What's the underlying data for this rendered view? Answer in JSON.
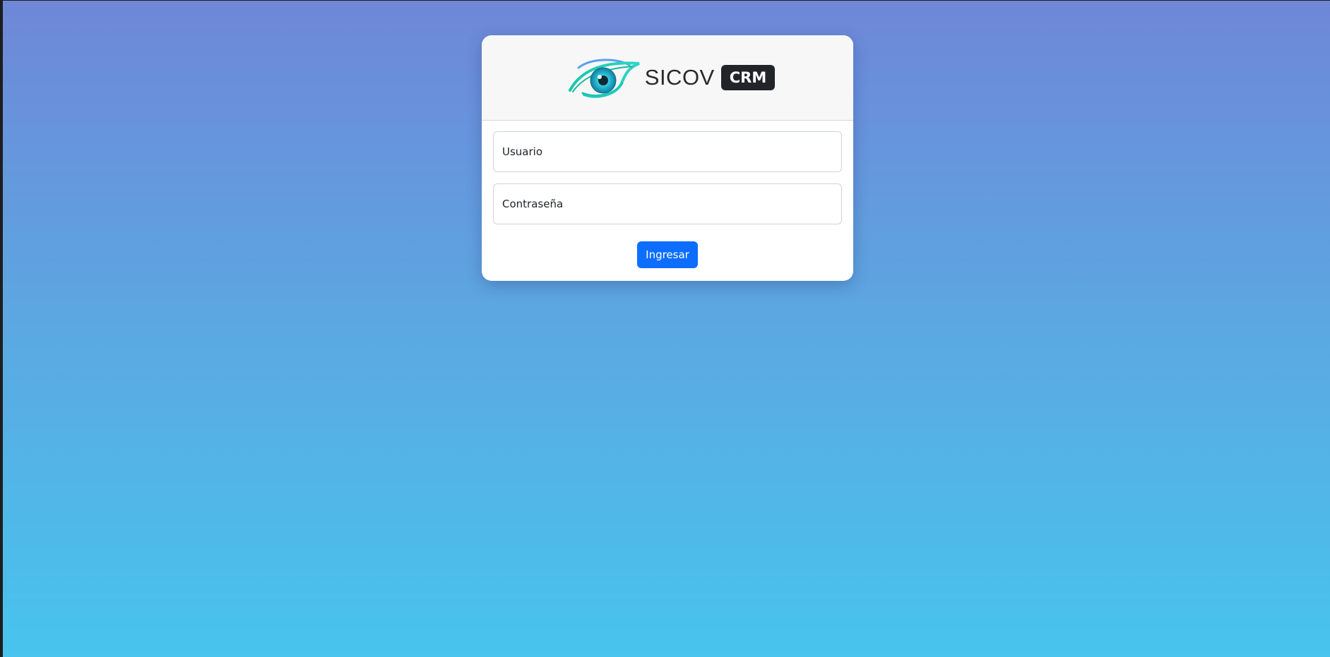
{
  "brand": {
    "name": "SICOV",
    "badge": "CRM",
    "logo_icon": "eye-icon"
  },
  "form": {
    "username_placeholder": "Usuario",
    "password_placeholder": "Contraseña",
    "submit_label": "Ingresar"
  },
  "colors": {
    "gradient_top": "#6f87d8",
    "gradient_bottom": "#48c4ee",
    "primary": "#0d6efd",
    "badge_bg": "#212529",
    "eye_teal": "#1cc6b8",
    "eye_blue": "#5aa0f0"
  }
}
